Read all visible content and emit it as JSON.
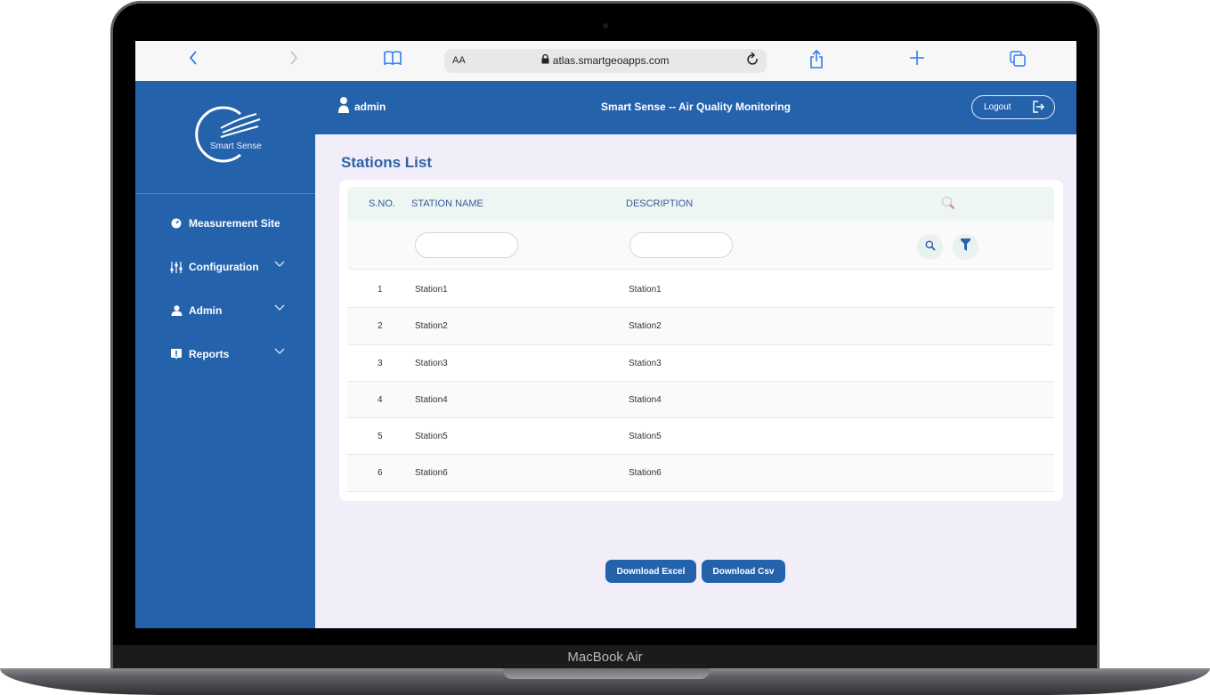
{
  "device": {
    "label": "MacBook Air"
  },
  "browser": {
    "url_display": "atlas.smartgeoapps.com",
    "text_size_label": "AA",
    "icons": [
      "back-icon",
      "forward-icon",
      "bookmarks-icon",
      "lock-icon",
      "reload-icon",
      "share-icon",
      "new-tab-icon",
      "tabs-icon"
    ]
  },
  "sidebar": {
    "logo_text": "Smart Sense",
    "items": [
      {
        "label": "Measurement Site",
        "icon": "gauge-icon",
        "expandable": false
      },
      {
        "label": "Configuration",
        "icon": "sliders-icon",
        "expandable": true
      },
      {
        "label": "Admin",
        "icon": "user-icon",
        "expandable": true
      },
      {
        "label": "Reports",
        "icon": "report-alert-icon",
        "expandable": true
      }
    ]
  },
  "header": {
    "username": "admin",
    "title": "Smart Sense -- Air Quality Monitoring",
    "logout_label": "Logout"
  },
  "main": {
    "page_title": "Stations List",
    "table": {
      "columns": [
        "S.NO.",
        "STATION NAME",
        "DESCRIPTION"
      ],
      "filters": {
        "station_name": "",
        "description": ""
      },
      "rows": [
        {
          "sno": "1",
          "name": "Station1",
          "description": "Station1"
        },
        {
          "sno": "2",
          "name": "Station2",
          "description": "Station2"
        },
        {
          "sno": "3",
          "name": "Station3",
          "description": "Station3"
        },
        {
          "sno": "4",
          "name": "Station4",
          "description": "Station4"
        },
        {
          "sno": "5",
          "name": "Station5",
          "description": "Station5"
        },
        {
          "sno": "6",
          "name": "Station6",
          "description": "Station6"
        }
      ]
    },
    "buttons": {
      "download_excel": "Download Excel",
      "download_csv": "Download Csv"
    }
  },
  "colors": {
    "primary": "#2562ac",
    "background": "#f1eef9",
    "header_row": "#edf6f2",
    "safari_accent": "#2e7bf6"
  }
}
